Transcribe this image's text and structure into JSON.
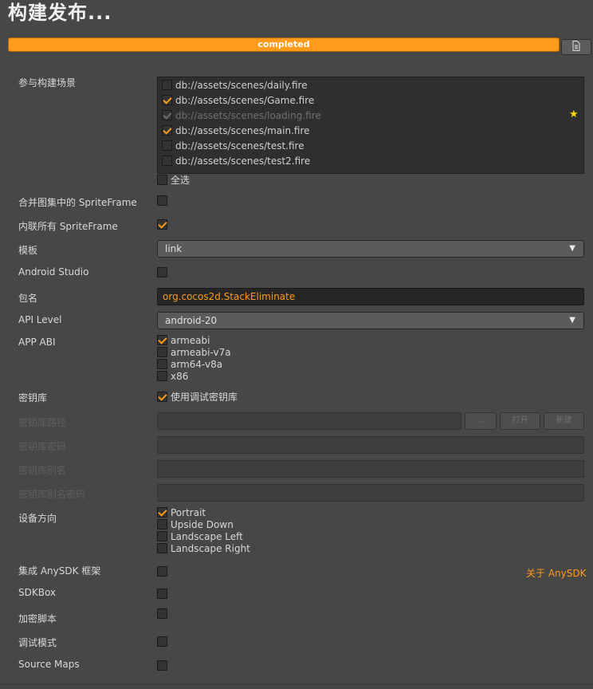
{
  "title": "构建发布...",
  "progress": {
    "text": "completed",
    "fraction": 1.0
  },
  "scenes": {
    "label": "参与构建场景",
    "items": [
      {
        "path": "db://assets/scenes/daily.fire",
        "checked": false,
        "disabled": false
      },
      {
        "path": "db://assets/scenes/Game.fire",
        "checked": true,
        "disabled": false
      },
      {
        "path": "db://assets/scenes/loading.fire",
        "checked": true,
        "disabled": true
      },
      {
        "path": "db://assets/scenes/main.fire",
        "checked": true,
        "disabled": false
      },
      {
        "path": "db://assets/scenes/test.fire",
        "checked": false,
        "disabled": false
      },
      {
        "path": "db://assets/scenes/test2.fire",
        "checked": false,
        "disabled": false
      }
    ],
    "select_all": "全选"
  },
  "merge_spriteframe": {
    "label": "合并图集中的 SpriteFrame",
    "checked": false
  },
  "inline_spriteframe": {
    "label": "内联所有 SpriteFrame",
    "checked": true
  },
  "template": {
    "label": "模板",
    "value": "link"
  },
  "android_studio": {
    "label": "Android Studio",
    "checked": false
  },
  "package_name": {
    "label": "包名",
    "value": "org.cocos2d.StackEliminate"
  },
  "api_level": {
    "label": "API Level",
    "value": "android-20"
  },
  "app_abi": {
    "label": "APP ABI",
    "options": [
      {
        "label": "armeabi",
        "checked": true
      },
      {
        "label": "armeabi-v7a",
        "checked": false
      },
      {
        "label": "arm64-v8a",
        "checked": false
      },
      {
        "label": "x86",
        "checked": false
      }
    ]
  },
  "keystore": {
    "label": "密钥库",
    "debug_label": "使用调试密钥库",
    "checked": true
  },
  "keystore_path": {
    "label": "密钥库路径",
    "dots": "...",
    "open": "打开",
    "new": "新建"
  },
  "keystore_password": {
    "label": "密钥库密码"
  },
  "keystore_alias": {
    "label": "密钥库别名"
  },
  "keystore_alias_password": {
    "label": "密钥库别名密码"
  },
  "orientation": {
    "label": "设备方向",
    "options": [
      {
        "label": "Portrait",
        "checked": true
      },
      {
        "label": "Upside Down",
        "checked": false
      },
      {
        "label": "Landscape Left",
        "checked": false
      },
      {
        "label": "Landscape Right",
        "checked": false
      }
    ]
  },
  "anysdk": {
    "label": "集成 AnySDK 框架",
    "checked": false,
    "link": "关于 AnySDK"
  },
  "sdkbox": {
    "label": "SDKBox",
    "checked": false
  },
  "encrypt_js": {
    "label": "加密脚本",
    "checked": false
  },
  "debug_mode": {
    "label": "调试模式",
    "checked": false
  },
  "source_maps": {
    "label": "Source Maps",
    "checked": false
  },
  "colors": {
    "accent": "#ff9a1a",
    "background": "#474747"
  }
}
